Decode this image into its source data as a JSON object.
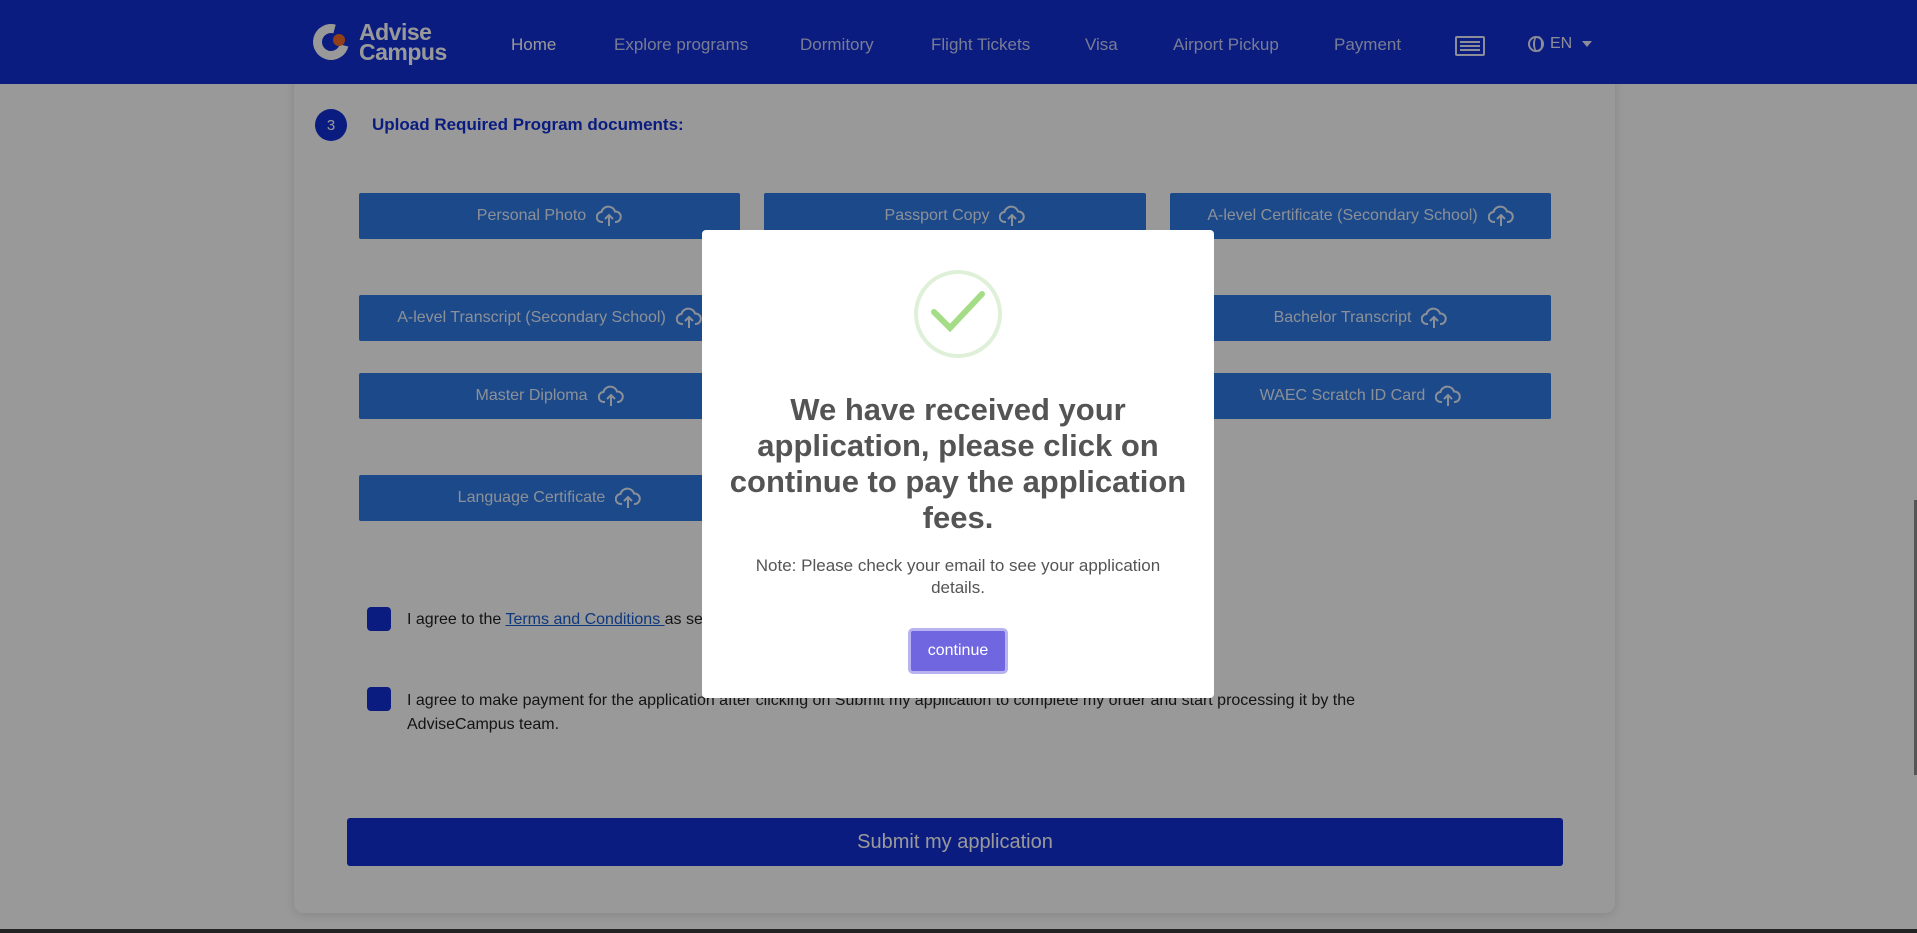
{
  "header": {
    "logo_line1": "Advise",
    "logo_line2": "Campus",
    "nav": [
      "Home",
      "Explore programs",
      "Dormitory",
      "Flight Tickets",
      "Visa",
      "Airport Pickup",
      "Payment"
    ],
    "active_nav": "Home",
    "lang_label": "EN",
    "icons": {
      "menu": "menu-icon",
      "globe": "globe-icon",
      "caret": "chevron-down-icon"
    },
    "colors": {
      "bar": "#1230d6",
      "logo_accent": "#f26b2a"
    }
  },
  "step": {
    "number": "3",
    "title": "Upload Required Program documents:"
  },
  "documents": [
    "Personal Photo",
    "Passport Copy",
    "A-level Certificate (Secondary School)",
    "A-level Transcript (Secondary School)",
    "Bachelor Transcript",
    "Master Diploma",
    "WAEC Scratch ID Card",
    "Language Certificate"
  ],
  "agreements": {
    "terms_prefix": "I agree to the ",
    "terms_link": "Terms and Conditions ",
    "terms_suffix": "as se",
    "payment_text": "I agree to make payment for the application after clicking on Submit my application to complete my order and start processing it by the AdviseCampus team."
  },
  "submit_label": "Submit my application",
  "modal": {
    "title": "We have received your application, please click on continue to pay the application fees.",
    "note": "Note: Please check your email to see your application details.",
    "button": "continue",
    "icon": "checkmark-icon",
    "colors": {
      "check": "#a5dc86",
      "button": "#7066e0"
    }
  }
}
